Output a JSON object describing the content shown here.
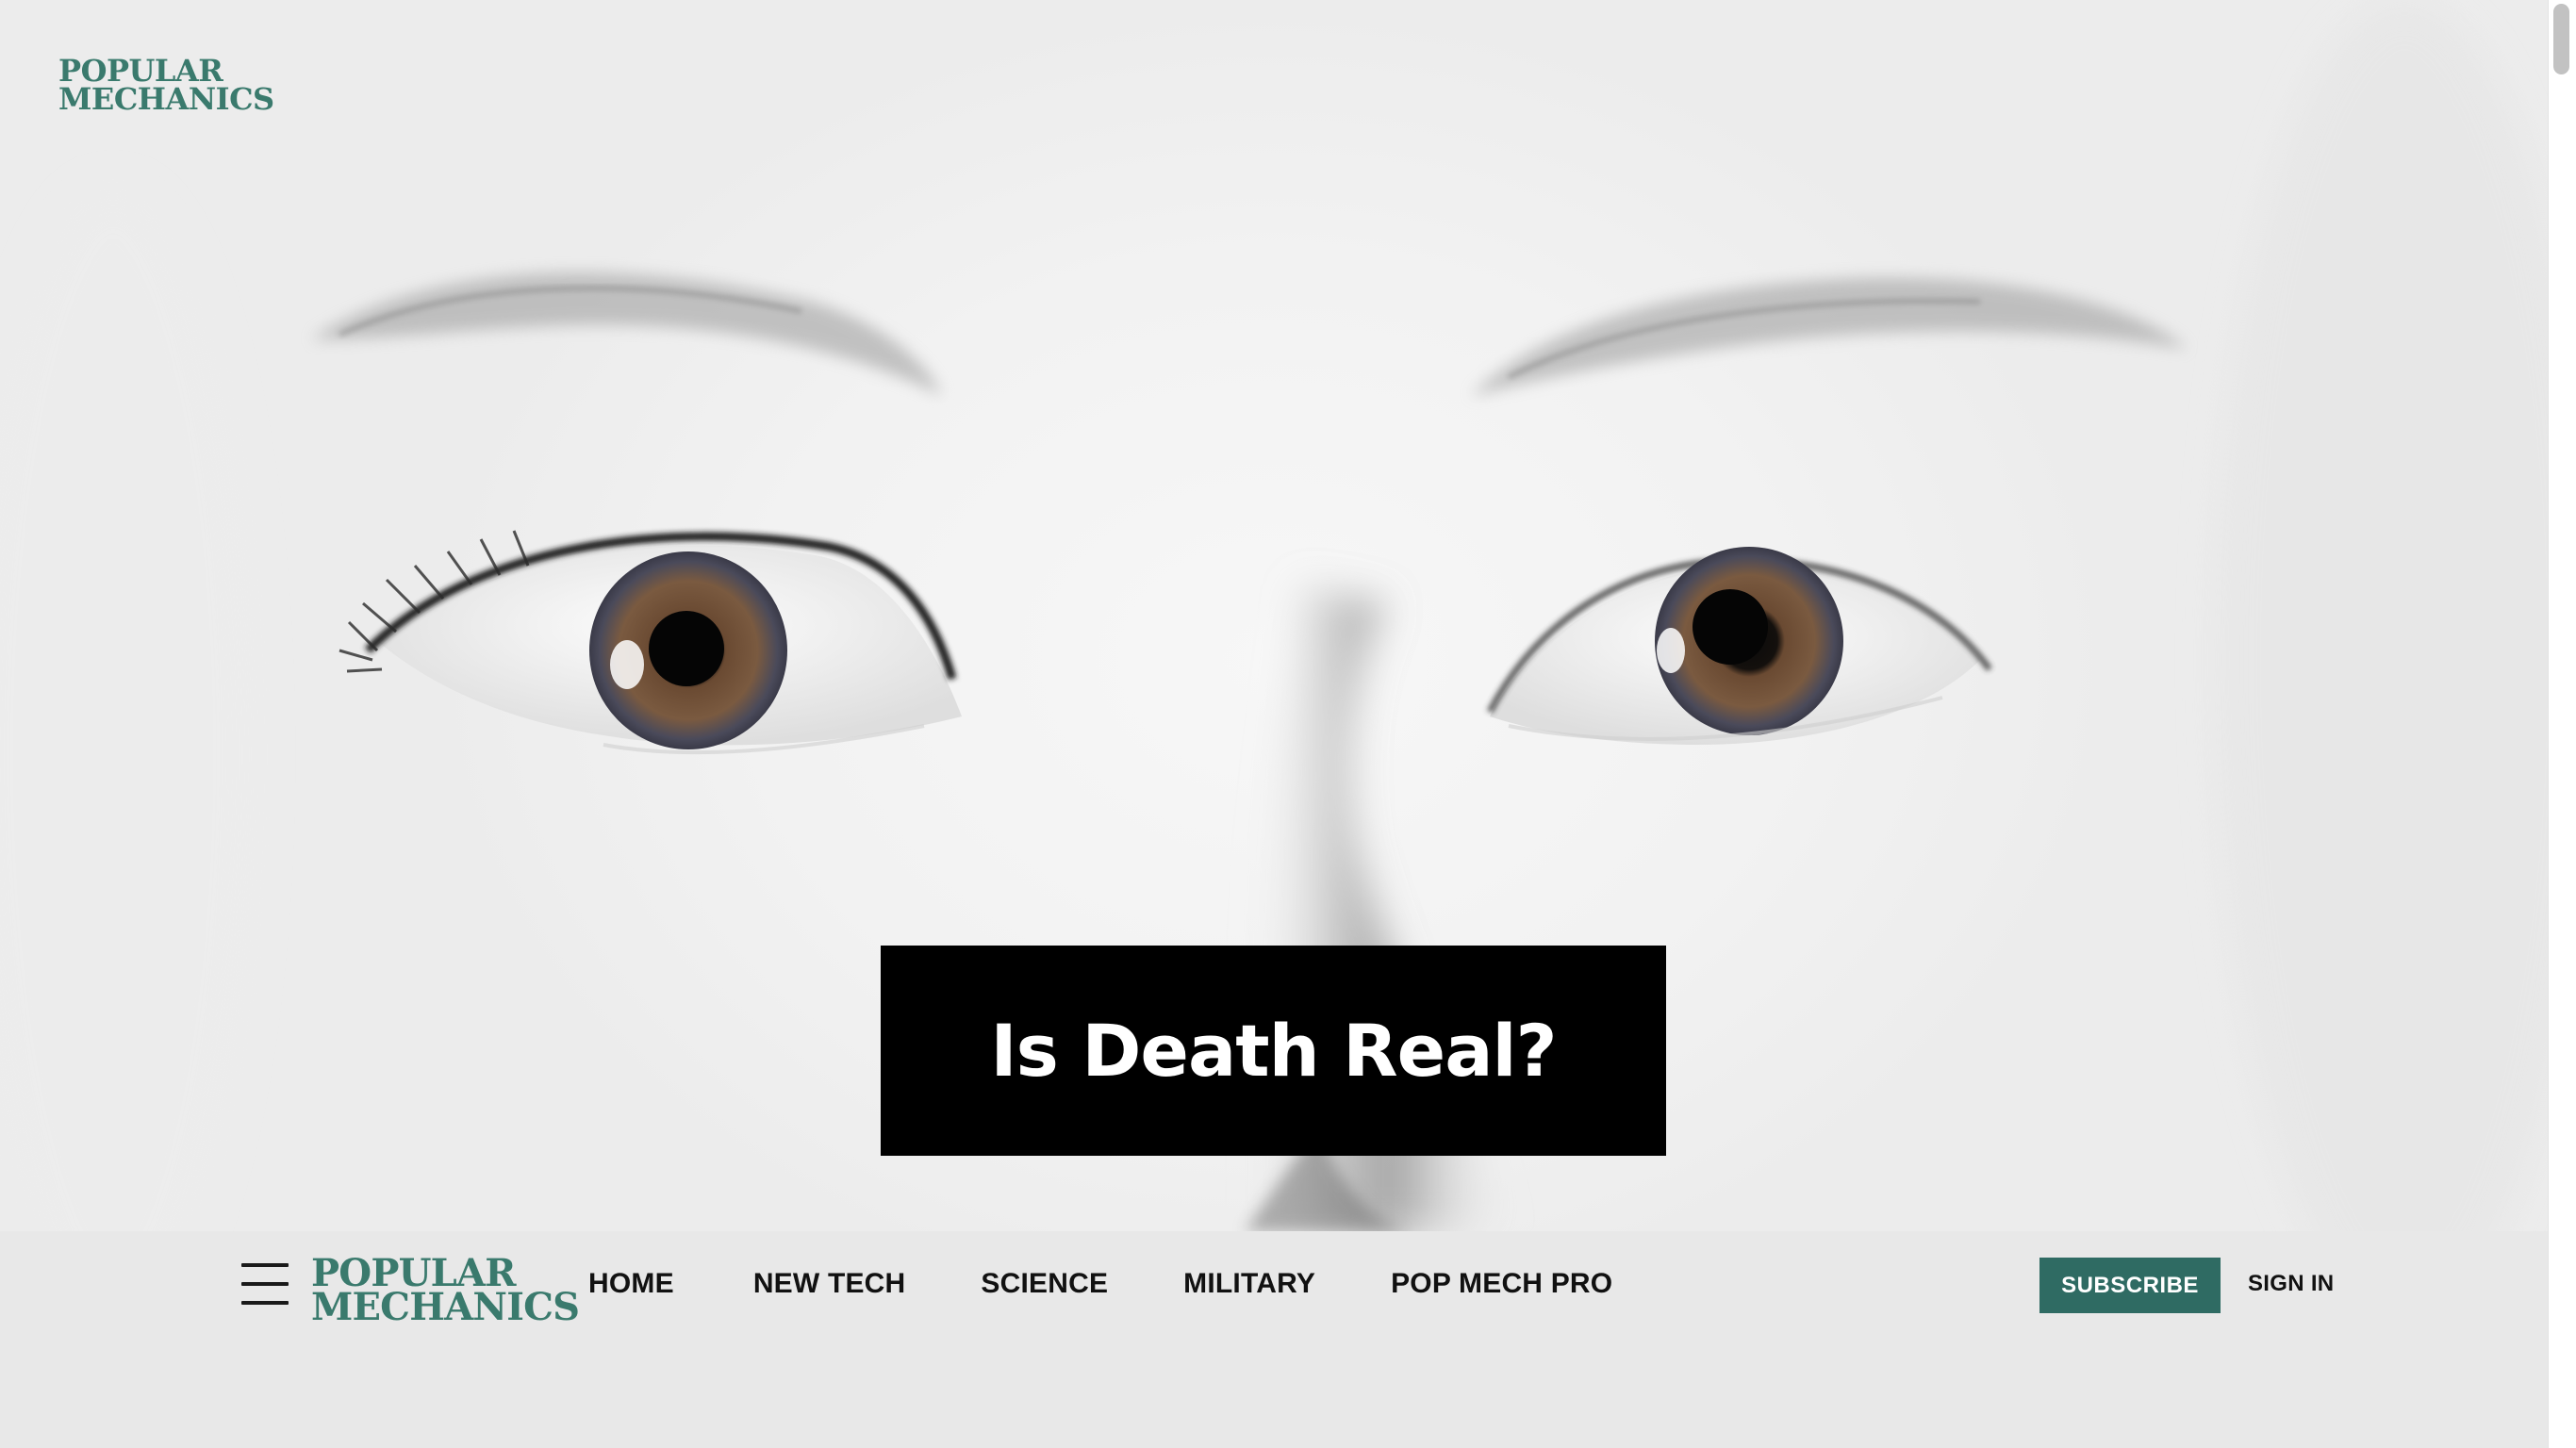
{
  "brand": {
    "name_line1": "POPULAR",
    "name_line2": "MECHANICS",
    "color": "#3a7a6d"
  },
  "hero": {
    "title": "Is Death Real?",
    "image_description_icon": "eyes-photo"
  },
  "nav": {
    "menu_icon": "hamburger-icon",
    "links": [
      {
        "label": "HOME"
      },
      {
        "label": "NEW TECH"
      },
      {
        "label": "SCIENCE"
      },
      {
        "label": "MILITARY"
      },
      {
        "label": "POP MECH PRO"
      }
    ],
    "subscribe_label": "SUBSCRIBE",
    "signin_label": "SIGN IN",
    "subscribe_color": "#2f6b63"
  }
}
